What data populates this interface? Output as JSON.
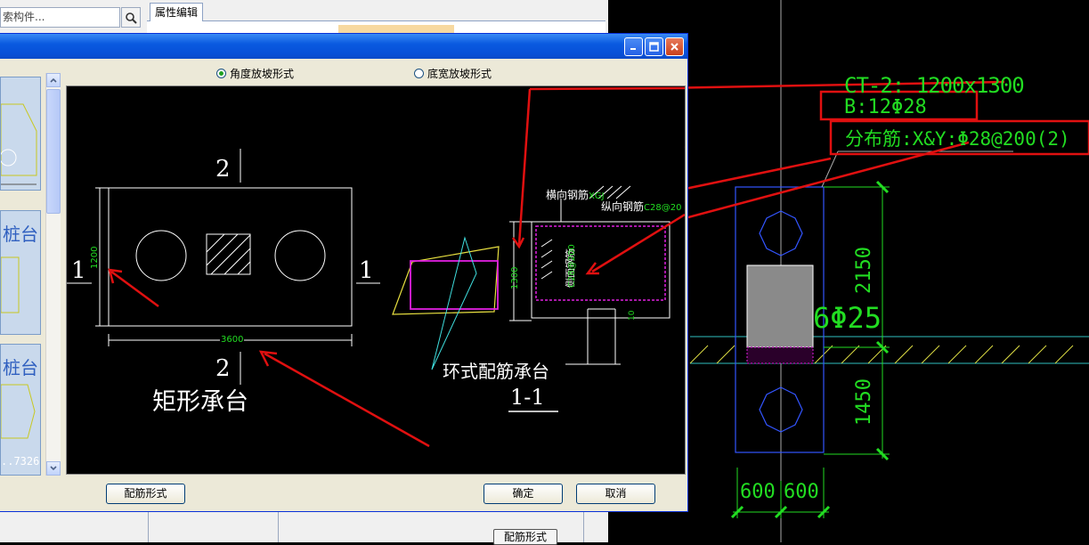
{
  "background_app": {
    "search_placeholder": "索构件...",
    "prop_tab_label": "属性编辑",
    "bottom_button_label": "配筋形式"
  },
  "dialog": {
    "radio_options": [
      {
        "label": "角度放坡形式",
        "selected": true
      },
      {
        "label": "底宽放坡形式",
        "selected": false
      }
    ],
    "thumbnails": [
      {
        "label": ""
      },
      {
        "label": "桩台"
      },
      {
        "label": "桩台",
        "sub": "..7326"
      }
    ],
    "drawing": {
      "section_mark_top": "2",
      "section_mark_bottom": "2",
      "section_mark_left": "1",
      "section_mark_right": "1",
      "dim_height": "1200",
      "dim_width": "3600",
      "title_rect": "矩形承台",
      "title_ring": "环式配筋承台",
      "section_label": "1-1",
      "label_transverse": "横向钢筋",
      "label_transverse_code": "XGJ",
      "label_longitudinal": "纵向钢筋",
      "label_longitudinal_code": "C28@20",
      "label_side": "侧面钢筋",
      "label_side_code": "C28@200",
      "dim_section_height": "1300",
      "dim_small": "10"
    },
    "footer": {
      "rebar_button": "配筋形式",
      "ok_button": "确定",
      "cancel_button": "取消"
    }
  },
  "cad": {
    "line1": "CT-2: 1200x1300",
    "line2": "B:12Φ28",
    "line3": "分布筋:X&Y:Φ28@200(2)",
    "dim_upper": "2150",
    "dim_lower": "1450",
    "rebar_label": "6Φ25",
    "dim_bottom_left": "600",
    "dim_bottom_right": "600"
  },
  "colors": {
    "cad_green": "#22dd22",
    "annotation_red": "#e01010",
    "cad_blue": "#3355ff",
    "magenta": "#e020e0",
    "cyan": "#40e0e0",
    "yellow": "#e8e040"
  }
}
